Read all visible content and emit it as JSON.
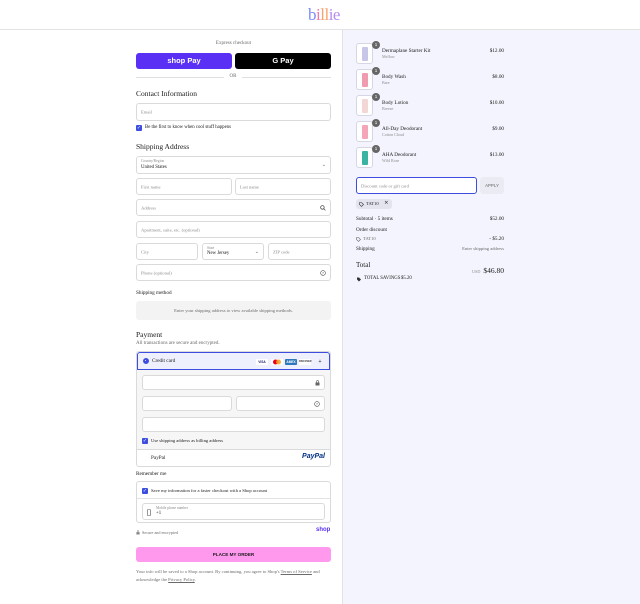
{
  "header": {
    "logo_text": "billie"
  },
  "express": {
    "label": "Express checkout",
    "shop_pay": "shop Pay",
    "gpay": "G Pay",
    "or": "OR"
  },
  "contact": {
    "title": "Contact Information",
    "email_placeholder": "Email",
    "newsletter_label": "Be the first to know when cool stuff happens"
  },
  "shipping": {
    "title": "Shipping Address",
    "country_label": "Country/Region",
    "country_value": "United States",
    "first_name": "First name",
    "last_name": "Last name",
    "address": "Address",
    "apartment": "Apartment, suite, etc. (optional)",
    "city": "City",
    "state_label": "State",
    "state_value": "New Jersey",
    "zip": "ZIP code",
    "phone": "Phone (optional)"
  },
  "shipping_method": {
    "title": "Shipping method",
    "message": "Enter your shipping address to view available shipping methods."
  },
  "payment": {
    "title": "Payment",
    "subtitle": "All transactions are secure and encrypted.",
    "credit_card": "Credit card",
    "card_logos": [
      "VISA",
      "MC",
      "AMEX",
      "DISCOVER",
      "+"
    ],
    "billing_label": "Use shipping address as billing address",
    "paypal_label": "PayPal",
    "paypal_logo": "PayPal"
  },
  "remember": {
    "title": "Remember me",
    "save_label": "Save my information for a faster checkout with a Shop account",
    "mobile_label": "Mobile phone number",
    "mobile_value": "+1",
    "secure_text": "Secure and encrypted",
    "shop_logo": "shop"
  },
  "place_order": "PLACE MY ORDER",
  "footer": {
    "text_before": "Your info will be saved to a Shop account. By continuing, you agree to Shop's",
    "terms": "Terms of Service",
    "and_text": "and acknowledge the",
    "privacy": "Privacy Policy",
    "period": "."
  },
  "cart": {
    "items": [
      {
        "qty": "1",
        "name": "Dermaplane Starter Kit",
        "variant": "Mellow",
        "price": "$12.00",
        "color": "#c7c6e8"
      },
      {
        "qty": "1",
        "name": "Body Wash",
        "variant": "Bare",
        "price": "$8.00",
        "color": "#f09cb0"
      },
      {
        "qty": "1",
        "name": "Body Lotion",
        "variant": "Breeze",
        "price": "$10.00",
        "color": "#f3d6d6"
      },
      {
        "qty": "1",
        "name": "All-Day Deodorant",
        "variant": "Cotton Cloud",
        "price": "$9.00",
        "color": "#f4a6b8"
      },
      {
        "qty": "1",
        "name": "AHA Deodorant",
        "variant": "Wild Rose",
        "price": "$13.00",
        "color": "#3bb3a3"
      }
    ],
    "discount_placeholder": "Discount code or gift card",
    "apply": "APPLY",
    "code_tag": "TAT10",
    "subtotal_label": "Subtotal · 5 items",
    "subtotal_value": "$52.00",
    "order_discount_label": "Order discount",
    "discount_code": "TAT10",
    "discount_value": "- $5.20",
    "shipping_label": "Shipping",
    "shipping_value": "Enter shipping address",
    "total_label": "Total",
    "currency": "USD",
    "total_value": "$46.80",
    "savings_label": "TOTAL SAVINGS",
    "savings_value": "$5.20"
  }
}
